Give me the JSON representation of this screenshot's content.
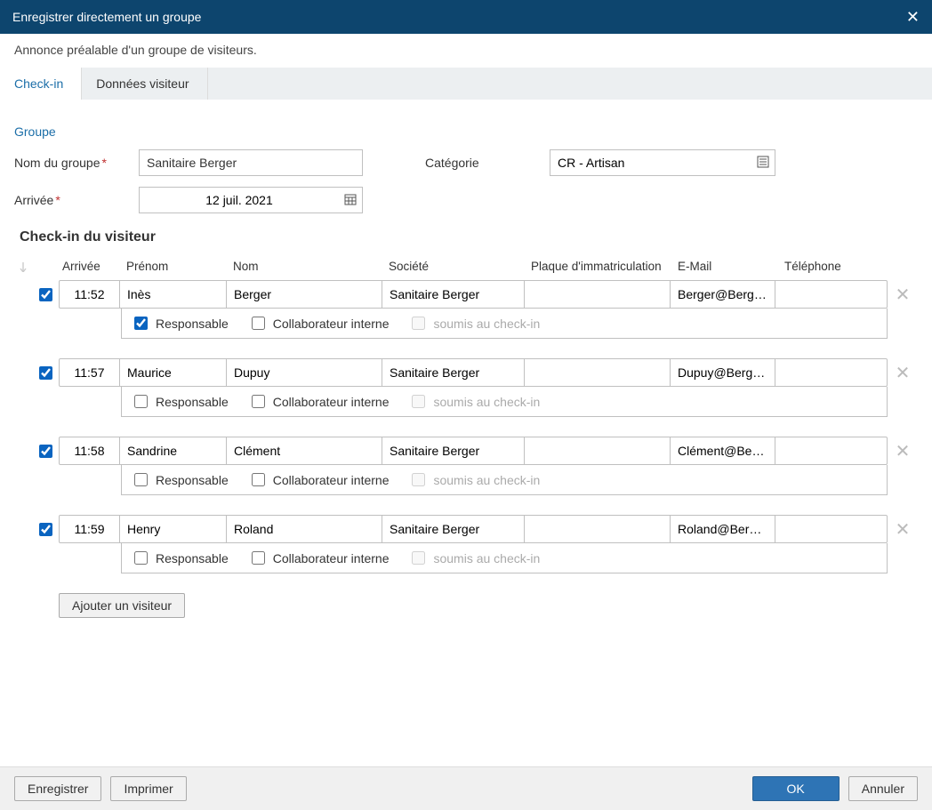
{
  "title": "Enregistrer directement un groupe",
  "subtitle": "Annonce préalable d'un groupe de visiteurs.",
  "tabs": {
    "checkin": "Check-in",
    "visitor_data": "Données visiteur"
  },
  "group": {
    "section": "Groupe",
    "name_label": "Nom du groupe",
    "name_value": "Sanitaire Berger",
    "category_label": "Catégorie",
    "category_value": "CR - Artisan",
    "arrival_label": "Arrivée",
    "arrival_value": "12 juil. 2021"
  },
  "checkin_header": "Check-in du visiteur",
  "columns": {
    "arrival": "Arrivée",
    "first": "Prénom",
    "last": "Nom",
    "company": "Société",
    "plate": "Plaque d'immatriculation",
    "email": "E-Mail",
    "phone": "Téléphone"
  },
  "flags": {
    "responsible": "Responsable",
    "internal": "Collaborateur interne",
    "subject": "soumis au check-in"
  },
  "visitors": [
    {
      "checked": true,
      "arrival": "11:52",
      "first": "Inès",
      "last": "Berger",
      "company": "Sanitaire Berger",
      "plate": "",
      "email": "Berger@Berger.com",
      "phone": "",
      "responsible": true,
      "internal": false,
      "subject": false
    },
    {
      "checked": true,
      "arrival": "11:57",
      "first": "Maurice",
      "last": "Dupuy",
      "company": "Sanitaire Berger",
      "plate": "",
      "email": "Dupuy@Berger.com",
      "phone": "",
      "responsible": false,
      "internal": false,
      "subject": false
    },
    {
      "checked": true,
      "arrival": "11:58",
      "first": "Sandrine",
      "last": "Clément",
      "company": "Sanitaire Berger",
      "plate": "",
      "email": "Clément@Berger.com",
      "phone": "",
      "responsible": false,
      "internal": false,
      "subject": false
    },
    {
      "checked": true,
      "arrival": "11:59",
      "first": "Henry",
      "last": "Roland",
      "company": "Sanitaire Berger",
      "plate": "",
      "email": "Roland@Berger.com",
      "phone": "",
      "responsible": false,
      "internal": false,
      "subject": false
    }
  ],
  "buttons": {
    "add": "Ajouter un visiteur",
    "save": "Enregistrer",
    "print": "Imprimer",
    "ok": "OK",
    "cancel": "Annuler"
  }
}
